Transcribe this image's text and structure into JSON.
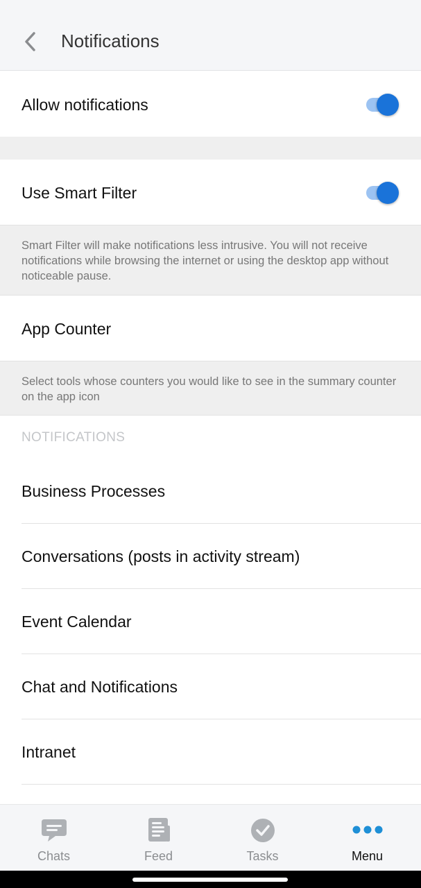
{
  "header": {
    "title": "Notifications",
    "back_icon": "chevron-left-icon"
  },
  "allow_notifications": {
    "label": "Allow notifications",
    "enabled": true
  },
  "smart_filter": {
    "label": "Use Smart Filter",
    "enabled": true,
    "description": "Smart Filter will make notifications less intrusive. You will not receive notifications while browsing the internet or using the desktop app without noticeable pause."
  },
  "app_counter": {
    "label": "App Counter",
    "description": "Select tools whose counters you would like to see in the summary counter on the app icon"
  },
  "notifications_section": {
    "header": "NOTIFICATIONS",
    "items": [
      {
        "label": "Business Processes"
      },
      {
        "label": "Conversations (posts in activity stream)"
      },
      {
        "label": "Event Calendar"
      },
      {
        "label": "Chat and Notifications"
      },
      {
        "label": "Intranet"
      }
    ]
  },
  "tabbar": {
    "tabs": [
      {
        "label": "Chats",
        "icon": "chat-bubble-icon",
        "active": false
      },
      {
        "label": "Feed",
        "icon": "newspaper-icon",
        "active": false
      },
      {
        "label": "Tasks",
        "icon": "check-circle-icon",
        "active": false
      },
      {
        "label": "Menu",
        "icon": "more-dots-icon",
        "active": true
      }
    ]
  },
  "colors": {
    "accent": "#1a73d9",
    "toggle_track": "#9cc3f2",
    "menu_dots": "#1e8fd6",
    "inactive_tab": "#aeb1b5",
    "section_header": "#c4c6c9"
  }
}
